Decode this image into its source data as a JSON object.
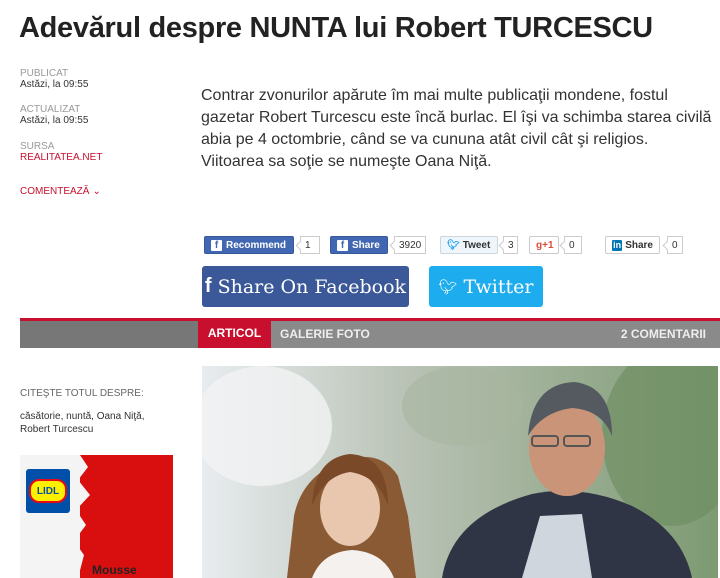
{
  "article": {
    "title": "Adevărul despre NUNTA lui Robert TURCESCU",
    "lead": "Contrar zvonurilor apărute îm mai multe publicaţii mondene, fostul gazetar Robert Turcescu este încă burlac. El îşi va schimba starea civilă abia pe 4 octombrie, când se va cununa atât civil cât şi religios. Viitoarea sa soţie se numeşte Oana Niţă."
  },
  "meta": {
    "published_label": "PUBLICAT",
    "published_value": "Astăzi, la 09:55",
    "updated_label": "ACTUALIZAT",
    "updated_value": "Astăzi, la 09:55",
    "source_label": "SURSA",
    "source_value": "REALITATEA.NET",
    "comment_label": "COMENTEAZĂ"
  },
  "social": {
    "recommend_label": "Recommend",
    "recommend_count": "1",
    "share_label": "Share",
    "share_count": "3920",
    "tweet_label": "Tweet",
    "tweet_count": "3",
    "gplus_label": "+1",
    "gplus_count": "0",
    "linkedin_label": "Share",
    "linkedin_count": "0",
    "big_facebook_label": "Share On Facebook",
    "big_twitter_label": "Twitter"
  },
  "tabs": {
    "article": "ARTICOL",
    "gallery": "GALERIE FOTO",
    "comments": "2 COMENTARII"
  },
  "tags": {
    "title": "CITEŞTE TOTUL DESPRE:",
    "list": "căsătorie, nuntă, Oana Niţă, Robert Turcescu"
  },
  "ad": {
    "brand": "LIDL",
    "text": "Mousse"
  },
  "colors": {
    "accent": "#c8102e",
    "facebook": "#3b5998",
    "twitter": "#1daced"
  }
}
